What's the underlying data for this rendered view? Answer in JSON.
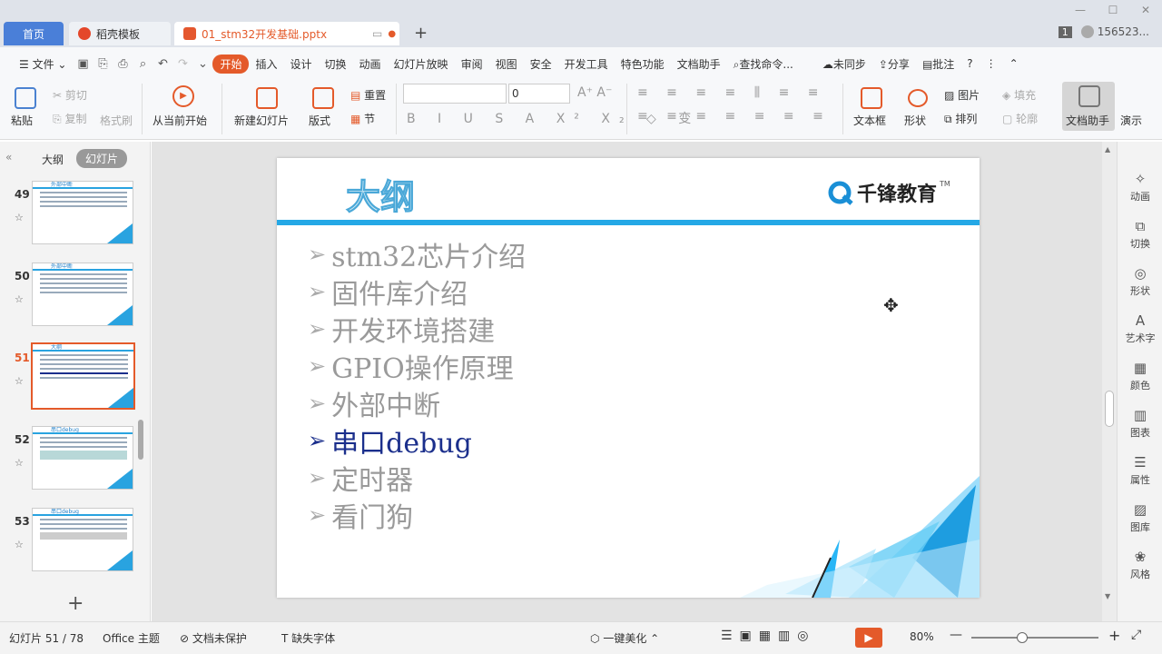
{
  "tabs": {
    "home": "首页",
    "daoke": "稻壳模板",
    "doc": "01_stm32开发基础.pptx"
  },
  "account": {
    "badge": "1",
    "user": "156523..."
  },
  "menu": {
    "file": "文件",
    "items": [
      "开始",
      "插入",
      "设计",
      "切换",
      "动画",
      "幻灯片放映",
      "审阅",
      "视图",
      "安全",
      "开发工具",
      "特色功能",
      "文档助手"
    ],
    "search": "查找命令...",
    "sync": "未同步",
    "share": "分享",
    "comment": "批注"
  },
  "ribbon": {
    "paste": "粘贴",
    "cut": "剪切",
    "copy": "复制",
    "format_painter": "格式刷",
    "from_current": "从当前开始",
    "new_slide": "新建幻灯片",
    "layout": "版式",
    "reset": "重置",
    "section": "节",
    "font_size": "0",
    "textbox": "文本框",
    "shape": "形状",
    "picture": "图片",
    "fill": "填充",
    "arrange": "排列",
    "outline": "轮廓",
    "doc_assistant": "文档助手",
    "present": "演示"
  },
  "panel": {
    "tab_outline": "大纲",
    "tab_slides": "幻灯片"
  },
  "thumbs": [
    {
      "num": "49",
      "title": "外部中断"
    },
    {
      "num": "50",
      "title": "外部中断"
    },
    {
      "num": "51",
      "title": "大纲"
    },
    {
      "num": "52",
      "title": "串口debug"
    },
    {
      "num": "53",
      "title": "串口debug"
    }
  ],
  "slide": {
    "title": "大纲",
    "brand": "千锋教育",
    "tm": "TM",
    "bullets": [
      "stm32芯片介绍",
      "固件库介绍",
      "开发环境搭建",
      "GPIO操作原理",
      "外部中断",
      "串口debug",
      "定时器",
      "看门狗"
    ],
    "highlight_index": 5
  },
  "rightpanel": [
    "动画",
    "切换",
    "形状",
    "艺术字",
    "颜色",
    "图表",
    "属性",
    "图库",
    "风格"
  ],
  "status": {
    "slide_pos": "幻灯片 51 / 78",
    "theme": "Office 主题",
    "protect": "文档未保护",
    "font": "缺失字体",
    "beautify": "一键美化",
    "zoom": "80%"
  },
  "colors": {
    "accent": "#e45a2a",
    "slide_blue": "#24a8e6",
    "highlight": "#1b2f8c"
  }
}
